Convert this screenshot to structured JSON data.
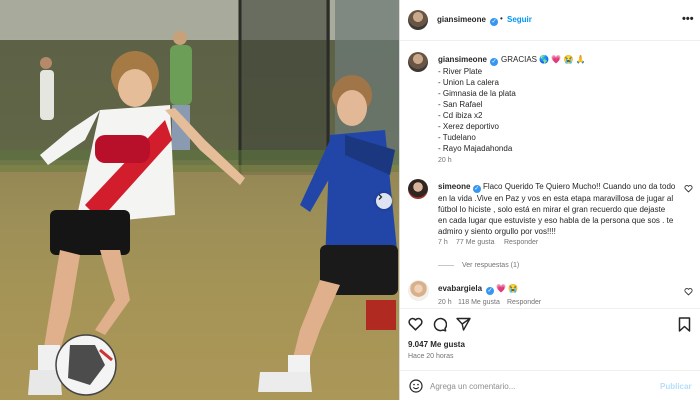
{
  "post": {
    "author": "giansimeone",
    "follow_label": "Seguir",
    "more_label": "•••"
  },
  "caption": {
    "author": "giansimeone",
    "text": "GRACIAS 🌎 💗 😭 🙏",
    "lines": [
      "- River Plate",
      "- Union La calera",
      "- Gimnasia de la plata",
      "- San Rafael",
      "- Cd ibiza x2",
      "- Xerez deportivo",
      "- Tudelano",
      "- Rayo Majadahonda"
    ],
    "time": "20 h"
  },
  "comments": [
    {
      "author": "simeone",
      "text": "Flaco Querido Te Quiero Mucho!! Cuando uno da todo en la vida .Vive en Paz y vos en esta etapa maravillosa de jugar al fútbol lo hiciste , solo está en mirar el gran recuerdo que dejaste en cada lugar que estuviste y eso habla de la persona que sos . te admiro y siento orgullo por vos!!!!",
      "time": "7 h",
      "likes": "77 Me gusta",
      "reply_label": "Responder",
      "view_replies": "Ver respuestas (1)"
    },
    {
      "author": "evabargiela",
      "text": "💗 😭",
      "time": "20 h",
      "likes": "118 Me gusta",
      "reply_label": "Responder"
    }
  ],
  "footer": {
    "likes": "9.047 Me gusta",
    "time_ago": "Hace 20 horas",
    "comment_placeholder": "Agrega un comentario...",
    "publish_label": "Publicar"
  },
  "colors": {
    "accent": "#0095f6",
    "verified": "#3797f0",
    "heart": "#e0245e"
  },
  "icons": {
    "verified": "verified-badge-icon",
    "like": "heart-icon",
    "comment": "comment-icon",
    "share": "share-icon",
    "save": "bookmark-icon",
    "emoji": "emoji-icon",
    "next": "chevron-right-icon"
  }
}
